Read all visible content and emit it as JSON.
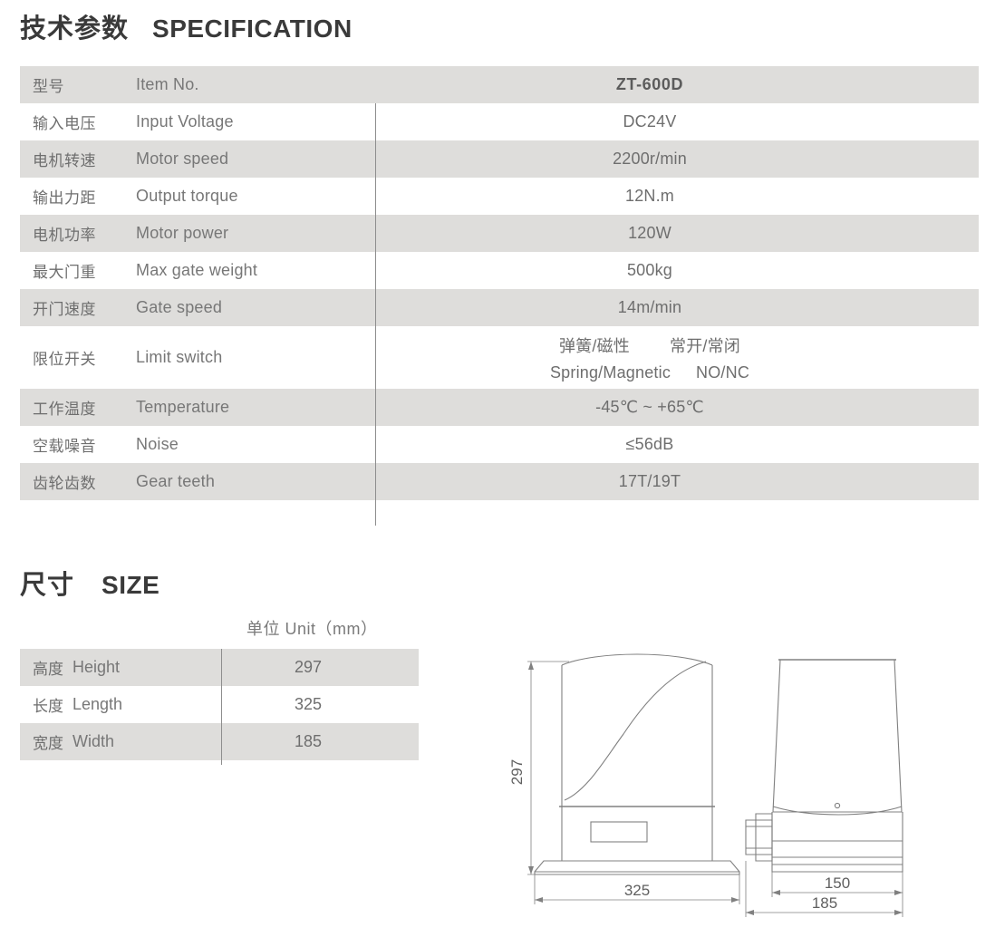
{
  "spec_section": {
    "heading_cn": "技术参数",
    "heading_en": "SPECIFICATION",
    "rows": [
      {
        "cn": "型号",
        "en": "Item No.",
        "value": "ZT-600D"
      },
      {
        "cn": "输入电压",
        "en": "Input Voltage",
        "value": "DC24V"
      },
      {
        "cn": "电机转速",
        "en": "Motor speed",
        "value": "2200r/min"
      },
      {
        "cn": "输出力距",
        "en": "Output torque",
        "value": "12N.m"
      },
      {
        "cn": "电机功率",
        "en": "Motor power",
        "value": "120W"
      },
      {
        "cn": "最大门重",
        "en": "Max gate weight",
        "value": "500kg"
      },
      {
        "cn": "开门速度",
        "en": "Gate speed",
        "value": "14m/min"
      },
      {
        "cn": "限位开关",
        "en": "Limit switch",
        "value_line1_a": "弹簧/磁性",
        "value_line1_b": "常开/常闭",
        "value_line2_a": "Spring/Magnetic",
        "value_line2_b": "NO/NC"
      },
      {
        "cn": "工作温度",
        "en": "Temperature",
        "value": "-45℃ ~ +65℃"
      },
      {
        "cn": "空载噪音",
        "en": "Noise",
        "value": "≤56dB"
      },
      {
        "cn": "齿轮齿数",
        "en": "Gear teeth",
        "value": "17T/19T"
      }
    ]
  },
  "size_section": {
    "heading_cn": "尺寸",
    "heading_en": "SIZE",
    "unit_label": "单位 Unit（mm）",
    "rows": [
      {
        "cn": "高度",
        "en": "Height",
        "value": "297"
      },
      {
        "cn": "长度",
        "en": "Length",
        "value": "325"
      },
      {
        "cn": "宽度",
        "en": "Width",
        "value": "185"
      }
    ]
  },
  "drawings": {
    "front_view": {
      "height_dim": "297",
      "width_dim": "325"
    },
    "side_view": {
      "inner_width_dim": "150",
      "outer_width_dim": "185"
    }
  },
  "colors": {
    "row_shaded": "#dedddb",
    "row_plain": "#ffffff",
    "text": "#6e6e6e",
    "heading": "#3a3a3a",
    "divider": "#8e8e8e",
    "drawing_stroke": "#808080"
  }
}
